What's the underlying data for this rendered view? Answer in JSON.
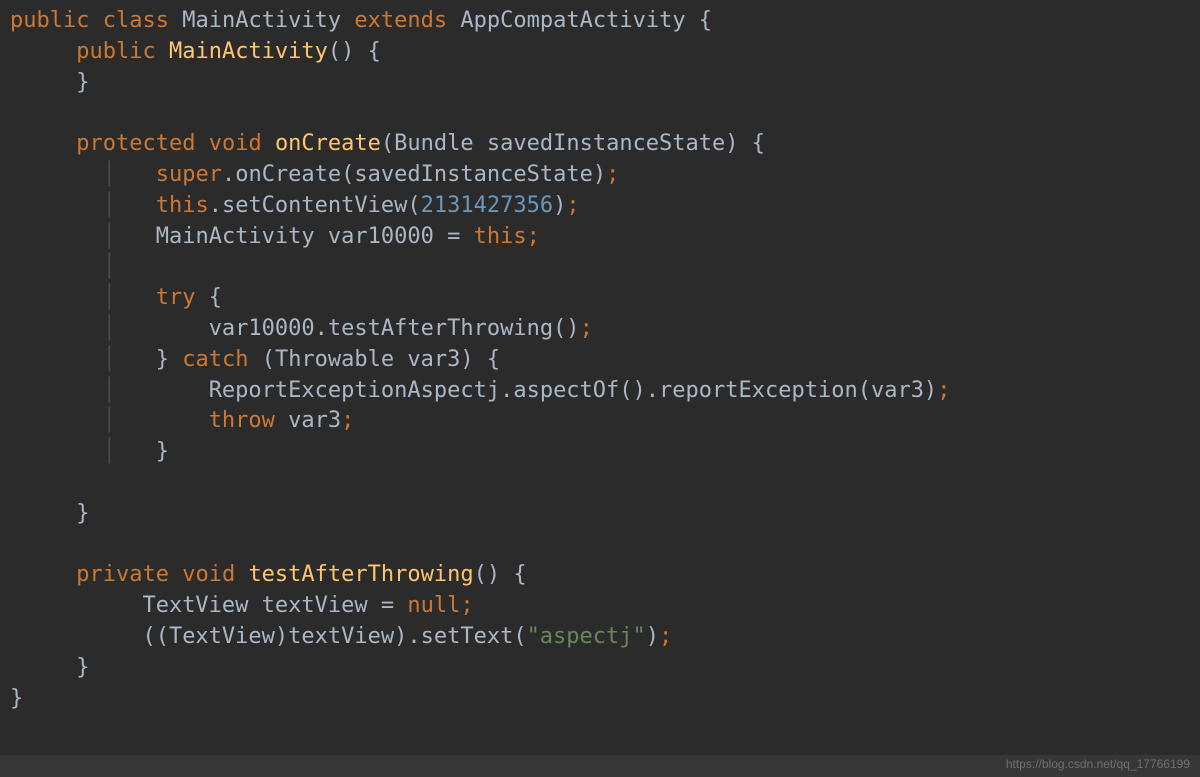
{
  "colors": {
    "background": "#2b2b2b",
    "default_text": "#a9b7c6",
    "keyword": "#cc7832",
    "method": "#ffc66d",
    "number": "#6897bb",
    "string": "#6a8759",
    "indent_guide": "#4b4b4b"
  },
  "language": "Java",
  "watermark": "https://blog.csdn.net/qq_17766199",
  "code": {
    "lines": [
      {
        "indent": 0,
        "tokens": [
          {
            "t": "public",
            "c": "kw"
          },
          {
            "t": " ",
            "c": "punct"
          },
          {
            "t": "class",
            "c": "kw"
          },
          {
            "t": " ",
            "c": "punct"
          },
          {
            "t": "MainActivity",
            "c": "type"
          },
          {
            "t": " ",
            "c": "punct"
          },
          {
            "t": "extends",
            "c": "kw"
          },
          {
            "t": " ",
            "c": "punct"
          },
          {
            "t": "AppCompatActivity",
            "c": "type"
          },
          {
            "t": " {",
            "c": "punct"
          }
        ]
      },
      {
        "indent": 1,
        "tokens": [
          {
            "t": "public",
            "c": "kw"
          },
          {
            "t": " ",
            "c": "punct"
          },
          {
            "t": "MainActivity",
            "c": "method"
          },
          {
            "t": "() {",
            "c": "punct"
          }
        ]
      },
      {
        "indent": 1,
        "tokens": [
          {
            "t": "}",
            "c": "punct"
          }
        ]
      },
      {
        "indent": 0,
        "tokens": []
      },
      {
        "indent": 1,
        "tokens": [
          {
            "t": "protected",
            "c": "kw"
          },
          {
            "t": " ",
            "c": "punct"
          },
          {
            "t": "void",
            "c": "kw"
          },
          {
            "t": " ",
            "c": "punct"
          },
          {
            "t": "onCreate",
            "c": "method"
          },
          {
            "t": "(Bundle savedInstanceState) {",
            "c": "punct"
          }
        ]
      },
      {
        "indent": 2,
        "guide": true,
        "tokens": [
          {
            "t": "super",
            "c": "kw"
          },
          {
            "t": ".onCreate(savedInstanceState)",
            "c": "call"
          },
          {
            "t": ";",
            "c": "semi"
          }
        ]
      },
      {
        "indent": 2,
        "guide": true,
        "tokens": [
          {
            "t": "this",
            "c": "kw"
          },
          {
            "t": ".setContentView(",
            "c": "call"
          },
          {
            "t": "2131427356",
            "c": "num"
          },
          {
            "t": ")",
            "c": "call"
          },
          {
            "t": ";",
            "c": "semi"
          }
        ]
      },
      {
        "indent": 2,
        "guide": true,
        "tokens": [
          {
            "t": "MainActivity var10000 = ",
            "c": "type"
          },
          {
            "t": "this",
            "c": "kw"
          },
          {
            "t": ";",
            "c": "semi"
          }
        ]
      },
      {
        "indent": 2,
        "guide": true,
        "tokens": []
      },
      {
        "indent": 2,
        "guide": true,
        "tokens": [
          {
            "t": "try",
            "c": "kw"
          },
          {
            "t": " {",
            "c": "punct"
          }
        ]
      },
      {
        "indent": 3,
        "guide": true,
        "tokens": [
          {
            "t": "var10000.testAfterThrowing()",
            "c": "call"
          },
          {
            "t": ";",
            "c": "semi"
          }
        ]
      },
      {
        "indent": 2,
        "guide": true,
        "tokens": [
          {
            "t": "} ",
            "c": "punct"
          },
          {
            "t": "catch",
            "c": "kw"
          },
          {
            "t": " (Throwable var3) {",
            "c": "punct"
          }
        ]
      },
      {
        "indent": 3,
        "guide": true,
        "tokens": [
          {
            "t": "ReportExceptionAspectj.",
            "c": "call"
          },
          {
            "t": "aspectOf",
            "c": "call"
          },
          {
            "t": "().reportException(var3)",
            "c": "call"
          },
          {
            "t": ";",
            "c": "semi"
          }
        ]
      },
      {
        "indent": 3,
        "guide": true,
        "tokens": [
          {
            "t": "throw",
            "c": "kw"
          },
          {
            "t": " var3",
            "c": "type"
          },
          {
            "t": ";",
            "c": "semi"
          }
        ]
      },
      {
        "indent": 2,
        "guide": true,
        "tokens": [
          {
            "t": "}",
            "c": "punct"
          }
        ]
      },
      {
        "indent": 0,
        "tokens": []
      },
      {
        "indent": 1,
        "tokens": [
          {
            "t": "}",
            "c": "punct"
          }
        ]
      },
      {
        "indent": 0,
        "tokens": []
      },
      {
        "indent": 1,
        "tokens": [
          {
            "t": "private",
            "c": "kw"
          },
          {
            "t": " ",
            "c": "punct"
          },
          {
            "t": "void",
            "c": "kw"
          },
          {
            "t": " ",
            "c": "punct"
          },
          {
            "t": "testAfterThrowing",
            "c": "method"
          },
          {
            "t": "() {",
            "c": "punct"
          }
        ]
      },
      {
        "indent": 2,
        "tokens": [
          {
            "t": "TextView textView = ",
            "c": "type"
          },
          {
            "t": "null",
            "c": "kw"
          },
          {
            "t": ";",
            "c": "semi"
          }
        ]
      },
      {
        "indent": 2,
        "tokens": [
          {
            "t": "((TextView)textView).setText(",
            "c": "call"
          },
          {
            "t": "\"aspectj\"",
            "c": "str"
          },
          {
            "t": ")",
            "c": "call"
          },
          {
            "t": ";",
            "c": "semi"
          }
        ]
      },
      {
        "indent": 1,
        "tokens": [
          {
            "t": "}",
            "c": "punct"
          }
        ]
      },
      {
        "indent": 0,
        "tokens": [
          {
            "t": "}",
            "c": "punct"
          }
        ]
      }
    ]
  }
}
